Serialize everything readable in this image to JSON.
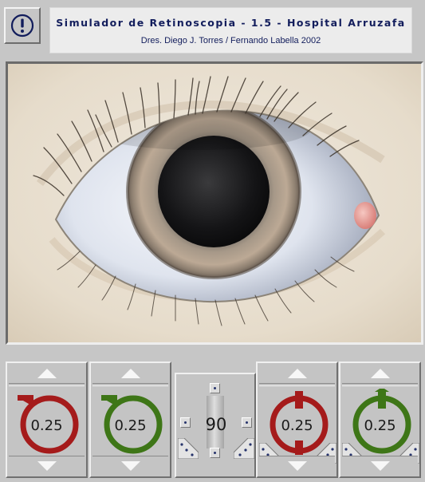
{
  "header": {
    "title": "Simulador de Retinoscopia - 1.5 - Hospital Arruzafa",
    "authors": "Dres. Diego J. Torres / Fernando Labella 2002",
    "info_icon": "exclamation-circle-icon"
  },
  "viewport": {
    "subject": "eye",
    "accent": "#121d5c"
  },
  "controls": {
    "lens_red_1": {
      "value": "0.25",
      "color": "#a51b1b"
    },
    "lens_green_1": {
      "value": "0.25",
      "color": "#3e7617"
    },
    "axis": {
      "value": "90"
    },
    "lens_red_2": {
      "value": "0.25",
      "color": "#a51b1b"
    },
    "lens_green_2": {
      "value": "0.25",
      "color": "#3e7617"
    }
  }
}
